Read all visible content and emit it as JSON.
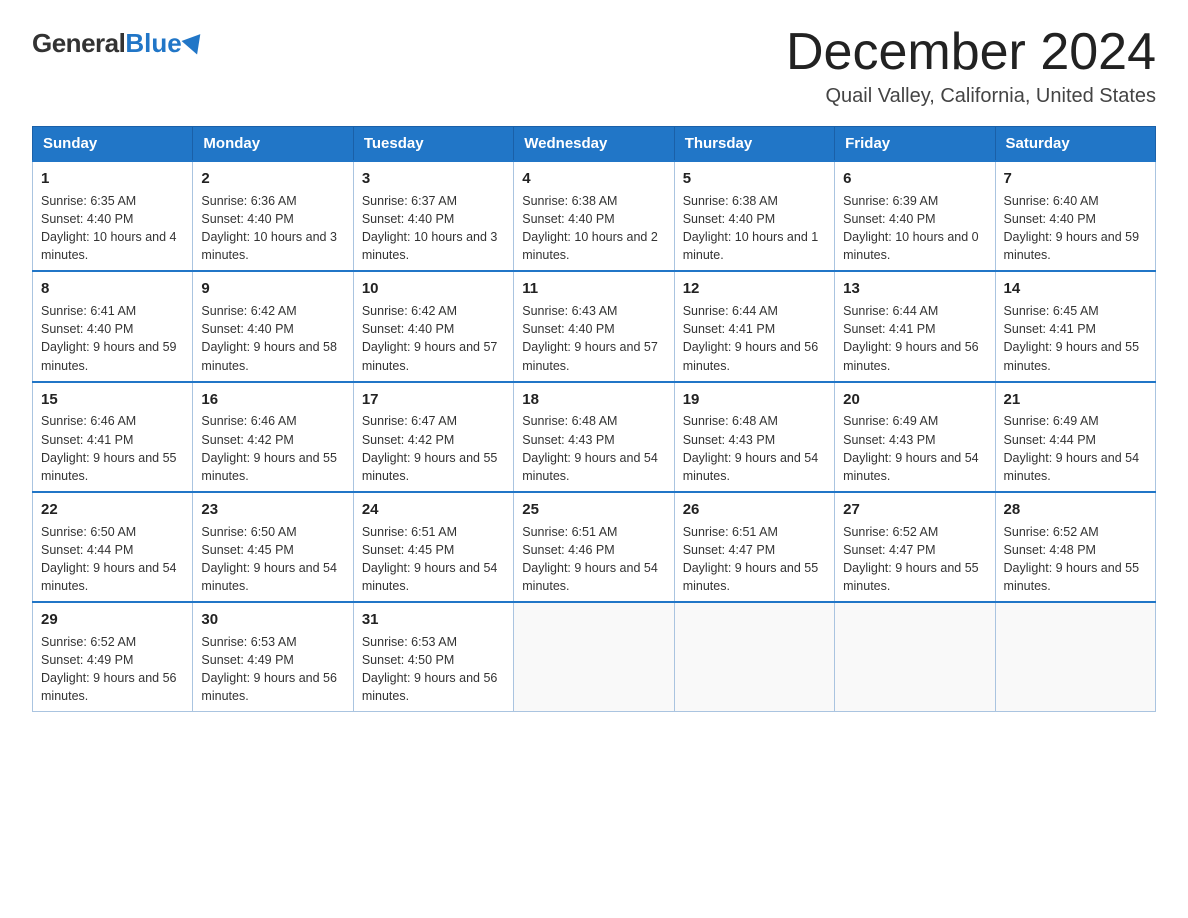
{
  "header": {
    "logo": {
      "general": "General",
      "blue": "Blue"
    },
    "title": "December 2024",
    "location": "Quail Valley, California, United States"
  },
  "calendar": {
    "days_of_week": [
      "Sunday",
      "Monday",
      "Tuesday",
      "Wednesday",
      "Thursday",
      "Friday",
      "Saturday"
    ],
    "weeks": [
      [
        {
          "day": "1",
          "sunrise": "6:35 AM",
          "sunset": "4:40 PM",
          "daylight": "10 hours and 4 minutes."
        },
        {
          "day": "2",
          "sunrise": "6:36 AM",
          "sunset": "4:40 PM",
          "daylight": "10 hours and 3 minutes."
        },
        {
          "day": "3",
          "sunrise": "6:37 AM",
          "sunset": "4:40 PM",
          "daylight": "10 hours and 3 minutes."
        },
        {
          "day": "4",
          "sunrise": "6:38 AM",
          "sunset": "4:40 PM",
          "daylight": "10 hours and 2 minutes."
        },
        {
          "day": "5",
          "sunrise": "6:38 AM",
          "sunset": "4:40 PM",
          "daylight": "10 hours and 1 minute."
        },
        {
          "day": "6",
          "sunrise": "6:39 AM",
          "sunset": "4:40 PM",
          "daylight": "10 hours and 0 minutes."
        },
        {
          "day": "7",
          "sunrise": "6:40 AM",
          "sunset": "4:40 PM",
          "daylight": "9 hours and 59 minutes."
        }
      ],
      [
        {
          "day": "8",
          "sunrise": "6:41 AM",
          "sunset": "4:40 PM",
          "daylight": "9 hours and 59 minutes."
        },
        {
          "day": "9",
          "sunrise": "6:42 AM",
          "sunset": "4:40 PM",
          "daylight": "9 hours and 58 minutes."
        },
        {
          "day": "10",
          "sunrise": "6:42 AM",
          "sunset": "4:40 PM",
          "daylight": "9 hours and 57 minutes."
        },
        {
          "day": "11",
          "sunrise": "6:43 AM",
          "sunset": "4:40 PM",
          "daylight": "9 hours and 57 minutes."
        },
        {
          "day": "12",
          "sunrise": "6:44 AM",
          "sunset": "4:41 PM",
          "daylight": "9 hours and 56 minutes."
        },
        {
          "day": "13",
          "sunrise": "6:44 AM",
          "sunset": "4:41 PM",
          "daylight": "9 hours and 56 minutes."
        },
        {
          "day": "14",
          "sunrise": "6:45 AM",
          "sunset": "4:41 PM",
          "daylight": "9 hours and 55 minutes."
        }
      ],
      [
        {
          "day": "15",
          "sunrise": "6:46 AM",
          "sunset": "4:41 PM",
          "daylight": "9 hours and 55 minutes."
        },
        {
          "day": "16",
          "sunrise": "6:46 AM",
          "sunset": "4:42 PM",
          "daylight": "9 hours and 55 minutes."
        },
        {
          "day": "17",
          "sunrise": "6:47 AM",
          "sunset": "4:42 PM",
          "daylight": "9 hours and 55 minutes."
        },
        {
          "day": "18",
          "sunrise": "6:48 AM",
          "sunset": "4:43 PM",
          "daylight": "9 hours and 54 minutes."
        },
        {
          "day": "19",
          "sunrise": "6:48 AM",
          "sunset": "4:43 PM",
          "daylight": "9 hours and 54 minutes."
        },
        {
          "day": "20",
          "sunrise": "6:49 AM",
          "sunset": "4:43 PM",
          "daylight": "9 hours and 54 minutes."
        },
        {
          "day": "21",
          "sunrise": "6:49 AM",
          "sunset": "4:44 PM",
          "daylight": "9 hours and 54 minutes."
        }
      ],
      [
        {
          "day": "22",
          "sunrise": "6:50 AM",
          "sunset": "4:44 PM",
          "daylight": "9 hours and 54 minutes."
        },
        {
          "day": "23",
          "sunrise": "6:50 AM",
          "sunset": "4:45 PM",
          "daylight": "9 hours and 54 minutes."
        },
        {
          "day": "24",
          "sunrise": "6:51 AM",
          "sunset": "4:45 PM",
          "daylight": "9 hours and 54 minutes."
        },
        {
          "day": "25",
          "sunrise": "6:51 AM",
          "sunset": "4:46 PM",
          "daylight": "9 hours and 54 minutes."
        },
        {
          "day": "26",
          "sunrise": "6:51 AM",
          "sunset": "4:47 PM",
          "daylight": "9 hours and 55 minutes."
        },
        {
          "day": "27",
          "sunrise": "6:52 AM",
          "sunset": "4:47 PM",
          "daylight": "9 hours and 55 minutes."
        },
        {
          "day": "28",
          "sunrise": "6:52 AM",
          "sunset": "4:48 PM",
          "daylight": "9 hours and 55 minutes."
        }
      ],
      [
        {
          "day": "29",
          "sunrise": "6:52 AM",
          "sunset": "4:49 PM",
          "daylight": "9 hours and 56 minutes."
        },
        {
          "day": "30",
          "sunrise": "6:53 AM",
          "sunset": "4:49 PM",
          "daylight": "9 hours and 56 minutes."
        },
        {
          "day": "31",
          "sunrise": "6:53 AM",
          "sunset": "4:50 PM",
          "daylight": "9 hours and 56 minutes."
        },
        null,
        null,
        null,
        null
      ]
    ]
  }
}
